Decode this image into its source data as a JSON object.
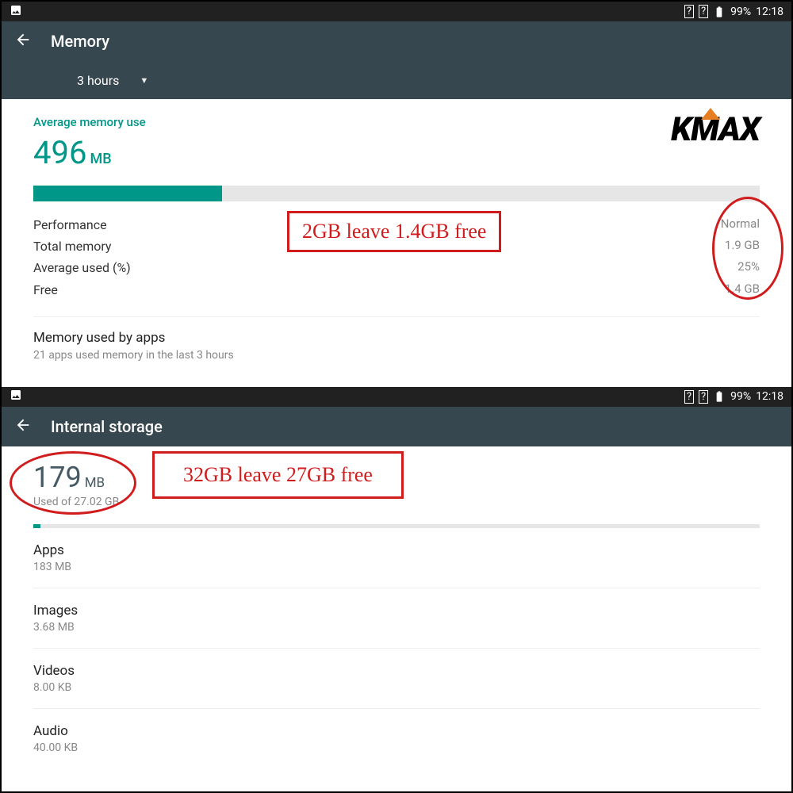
{
  "status": {
    "battery_pct": "99%",
    "time": "12:18"
  },
  "memory": {
    "title": "Memory",
    "period_label": "3 hours",
    "avg_label": "Average memory use",
    "avg_value": "496",
    "avg_unit": "MB",
    "progress_pct": 26,
    "stats": [
      {
        "label": "Performance",
        "value": "Normal"
      },
      {
        "label": "Total memory",
        "value": "1.9 GB"
      },
      {
        "label": "Average used (%)",
        "value": "25%"
      },
      {
        "label": "Free",
        "value": "1.4 GB"
      }
    ],
    "apps_used_title": "Memory used by apps",
    "apps_used_sub": "21 apps used memory in the last 3 hours",
    "annotation": "2GB leave 1.4GB free"
  },
  "storage": {
    "title": "Internal storage",
    "used_value": "179",
    "used_unit": "MB",
    "used_sub": "Used of 27.02 GB",
    "annotation": "32GB leave 27GB free",
    "items": [
      {
        "name": "Apps",
        "size": "183 MB"
      },
      {
        "name": "Images",
        "size": "3.68 MB"
      },
      {
        "name": "Videos",
        "size": "8.00 KB"
      },
      {
        "name": "Audio",
        "size": "40.00 KB"
      }
    ]
  },
  "logo_text": "KMAX"
}
